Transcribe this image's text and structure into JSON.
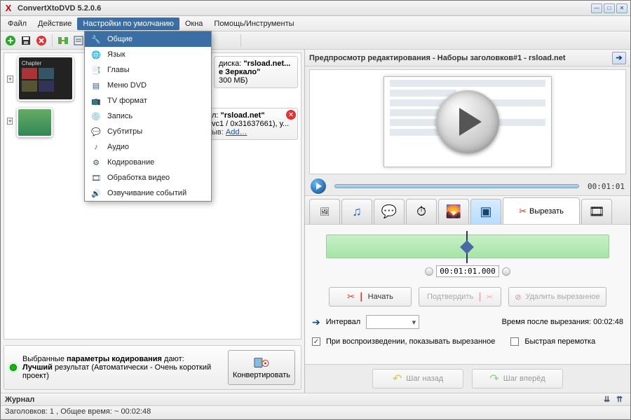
{
  "app": {
    "title": "ConvertXtoDVD 5.2.0.6"
  },
  "menubar": {
    "file": "Файл",
    "action": "Действие",
    "settings": "Настройки по умолчанию",
    "windows": "Окна",
    "help": "Помощь/Инструменты"
  },
  "dropdown": {
    "items": [
      "Общие",
      "Язык",
      "Главы",
      "Меню DVD",
      "TV формат",
      "Запись",
      "Субтитры",
      "Аудио",
      "Кодирование",
      "Обработка видео",
      "Озвучивание событий"
    ]
  },
  "disk": {
    "label_prefix": "диска: ",
    "label_value": "\"rsload.net...",
    "line2": "е Зеркало\"",
    "line3": "300 МБ)"
  },
  "clip": {
    "title_prefix": "л: ",
    "title_value": "\"rsload.net\"",
    "codec": "vc1 / 0x31637661), у...",
    "addmore": "Add…"
  },
  "encode": {
    "line1a": "Выбранные ",
    "line1b": "параметры кодирования",
    "line1c": " дают:",
    "line2a": "Лучший",
    "line2b": " результат (Автоматически - Очень короткий проект)"
  },
  "convert_btn": "Конвертировать",
  "preview": {
    "title": "Предпросмотр редактирования - Наборы заголовков#1 - rsload.net",
    "time": "00:01:01"
  },
  "tabs": {
    "cut": "Вырезать"
  },
  "timeline": {
    "position": "00:01:01.000"
  },
  "buttons": {
    "start": "Начать",
    "confirm": "Подтвердить",
    "delete_cut": "Удалить вырезанное"
  },
  "interval": {
    "label": "Интервал",
    "after_label": "Время после вырезания: ",
    "after_value": "00:02:48"
  },
  "checks": {
    "show_cut": "При воспроизведении, показывать вырезанное",
    "fast": "Быстрая перемотка"
  },
  "nav": {
    "back": "Шаг назад",
    "forward": "Шаг вперёд"
  },
  "journal": {
    "label": "Журнал"
  },
  "status": {
    "text": "Заголовков: 1 , Общее время: ~ 00:02:48"
  }
}
